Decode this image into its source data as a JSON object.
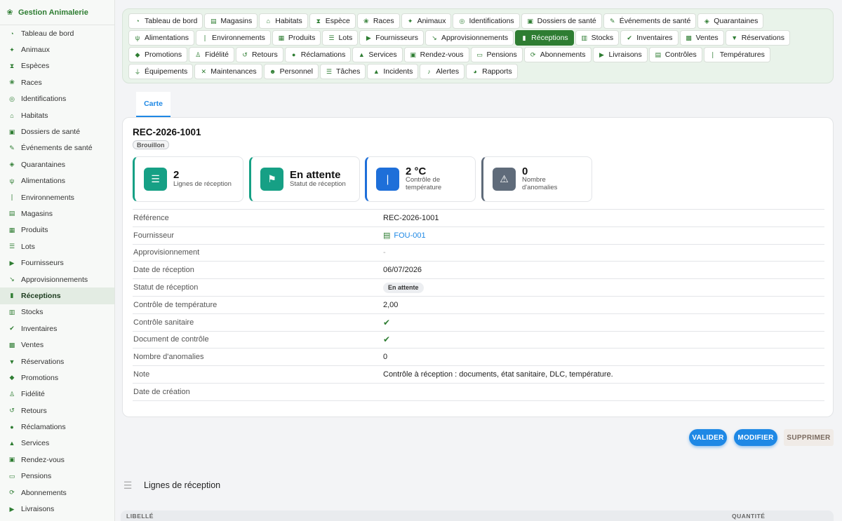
{
  "app": {
    "title": "Gestion Animalerie"
  },
  "sidebar": {
    "items": [
      {
        "label": "Tableau de bord",
        "icon": "dashboard-icon",
        "glyph": "◔"
      },
      {
        "label": "Animaux",
        "icon": "dog-icon",
        "glyph": "✦"
      },
      {
        "label": "Espèces",
        "icon": "hourglass-icon",
        "glyph": "⧗"
      },
      {
        "label": "Races",
        "icon": "paw-icon",
        "glyph": "❀"
      },
      {
        "label": "Identifications",
        "icon": "fingerprint-icon",
        "glyph": "◎"
      },
      {
        "label": "Habitats",
        "icon": "home-icon",
        "glyph": "⌂"
      },
      {
        "label": "Dossiers de santé",
        "icon": "file-medical-icon",
        "glyph": "▣"
      },
      {
        "label": "Événements de santé",
        "icon": "syringe-icon",
        "glyph": "✎"
      },
      {
        "label": "Quarantaines",
        "icon": "shield-icon",
        "glyph": "◈"
      },
      {
        "label": "Alimentations",
        "icon": "utensils-icon",
        "glyph": "ψ"
      },
      {
        "label": "Environnements",
        "icon": "thermometer-icon",
        "glyph": "❘"
      },
      {
        "label": "Magasins",
        "icon": "store-icon",
        "glyph": "▤"
      },
      {
        "label": "Produits",
        "icon": "box-icon",
        "glyph": "▦"
      },
      {
        "label": "Lots",
        "icon": "layers-icon",
        "glyph": "☰"
      },
      {
        "label": "Fournisseurs",
        "icon": "truck-icon",
        "glyph": "▶"
      },
      {
        "label": "Approvisionnements",
        "icon": "dolly-icon",
        "glyph": "↘"
      },
      {
        "label": "Réceptions",
        "icon": "truck-loading-icon",
        "glyph": "▮"
      },
      {
        "label": "Stocks",
        "icon": "warehouse-icon",
        "glyph": "▥"
      },
      {
        "label": "Inventaires",
        "icon": "clipboard-check-icon",
        "glyph": "✔"
      },
      {
        "label": "Ventes",
        "icon": "cash-register-icon",
        "glyph": "▩"
      },
      {
        "label": "Réservations",
        "icon": "bookmark-icon",
        "glyph": "▼"
      },
      {
        "label": "Promotions",
        "icon": "tags-icon",
        "glyph": "◆"
      },
      {
        "label": "Fidélité",
        "icon": "award-icon",
        "glyph": "♙"
      },
      {
        "label": "Retours",
        "icon": "undo-icon",
        "glyph": "↺"
      },
      {
        "label": "Réclamations",
        "icon": "comment-icon",
        "glyph": "●"
      },
      {
        "label": "Services",
        "icon": "concierge-bell-icon",
        "glyph": "▲"
      },
      {
        "label": "Rendez-vous",
        "icon": "calendar-check-icon",
        "glyph": "▣"
      },
      {
        "label": "Pensions",
        "icon": "bed-icon",
        "glyph": "▭"
      },
      {
        "label": "Abonnements",
        "icon": "sync-icon",
        "glyph": "⟳"
      },
      {
        "label": "Livraisons",
        "icon": "shipping-fast-icon",
        "glyph": "▶"
      }
    ],
    "active_index": 16
  },
  "nav_tabs": [
    {
      "label": "Tableau de bord",
      "icon": "dashboard-icon",
      "glyph": "◔"
    },
    {
      "label": "Magasins",
      "icon": "store-icon",
      "glyph": "▤"
    },
    {
      "label": "Habitats",
      "icon": "home-icon",
      "glyph": "⌂"
    },
    {
      "label": "Espèce",
      "icon": "hourglass-icon",
      "glyph": "⧗"
    },
    {
      "label": "Races",
      "icon": "paw-icon",
      "glyph": "❀"
    },
    {
      "label": "Animaux",
      "icon": "dog-icon",
      "glyph": "✦"
    },
    {
      "label": "Identifications",
      "icon": "fingerprint-icon",
      "glyph": "◎"
    },
    {
      "label": "Dossiers de santé",
      "icon": "file-medical-icon",
      "glyph": "▣"
    },
    {
      "label": "Événements de santé",
      "icon": "syringe-icon",
      "glyph": "✎"
    },
    {
      "label": "Quarantaines",
      "icon": "shield-icon",
      "glyph": "◈"
    },
    {
      "label": "Alimentations",
      "icon": "utensils-icon",
      "glyph": "ψ"
    },
    {
      "label": "Environnements",
      "icon": "thermometer-icon",
      "glyph": "❘"
    },
    {
      "label": "Produits",
      "icon": "box-icon",
      "glyph": "▦"
    },
    {
      "label": "Lots",
      "icon": "layers-icon",
      "glyph": "☰"
    },
    {
      "label": "Fournisseurs",
      "icon": "truck-icon",
      "glyph": "▶"
    },
    {
      "label": "Approvisionnements",
      "icon": "dolly-icon",
      "glyph": "↘"
    },
    {
      "label": "Réceptions",
      "icon": "truck-loading-icon",
      "glyph": "▮"
    },
    {
      "label": "Stocks",
      "icon": "warehouse-icon",
      "glyph": "▥"
    },
    {
      "label": "Inventaires",
      "icon": "clipboard-check-icon",
      "glyph": "✔"
    },
    {
      "label": "Ventes",
      "icon": "cash-register-icon",
      "glyph": "▩"
    },
    {
      "label": "Réservations",
      "icon": "bookmark-icon",
      "glyph": "▼"
    },
    {
      "label": "Promotions",
      "icon": "tags-icon",
      "glyph": "◆"
    },
    {
      "label": "Fidélité",
      "icon": "award-icon",
      "glyph": "♙"
    },
    {
      "label": "Retours",
      "icon": "undo-icon",
      "glyph": "↺"
    },
    {
      "label": "Réclamations",
      "icon": "comment-icon",
      "glyph": "●"
    },
    {
      "label": "Services",
      "icon": "concierge-bell-icon",
      "glyph": "▲"
    },
    {
      "label": "Rendez-vous",
      "icon": "calendar-check-icon",
      "glyph": "▣"
    },
    {
      "label": "Pensions",
      "icon": "bed-icon",
      "glyph": "▭"
    },
    {
      "label": "Abonnements",
      "icon": "sync-icon",
      "glyph": "⟳"
    },
    {
      "label": "Livraisons",
      "icon": "shipping-fast-icon",
      "glyph": "▶"
    },
    {
      "label": "Contrôles",
      "icon": "clipboard-icon",
      "glyph": "▤"
    },
    {
      "label": "Températures",
      "icon": "thermometer-icon",
      "glyph": "❘"
    },
    {
      "label": "Équipements",
      "icon": "plug-icon",
      "glyph": "⏚"
    },
    {
      "label": "Maintenances",
      "icon": "tools-icon",
      "glyph": "✕"
    },
    {
      "label": "Personnel",
      "icon": "users-icon",
      "glyph": "☻"
    },
    {
      "label": "Tâches",
      "icon": "tasks-icon",
      "glyph": "☰"
    },
    {
      "label": "Incidents",
      "icon": "warning-icon",
      "glyph": "▲"
    },
    {
      "label": "Alertes",
      "icon": "bell-icon",
      "glyph": "♪"
    },
    {
      "label": "Rapports",
      "icon": "chart-pie-icon",
      "glyph": "◕"
    }
  ],
  "nav_active_index": 16,
  "view_tab": {
    "label": "Carte"
  },
  "record": {
    "title": "REC-2026-1001",
    "status_badge": "Brouillon"
  },
  "stats": [
    {
      "value": "2",
      "label": "Lignes de réception",
      "icon": "list-icon",
      "glyph": "☰",
      "color": "#16a085",
      "border": "#16a085"
    },
    {
      "value": "En attente",
      "label": "Statut de réception",
      "icon": "flag-icon",
      "glyph": "⚑",
      "color": "#16a085",
      "border": "#16a085"
    },
    {
      "value": "2 °C",
      "label": "Contrôle de température",
      "icon": "thermometer-icon",
      "glyph": "❘",
      "color": "#1e6fd9",
      "border": "#1e6fd9"
    },
    {
      "value": "0",
      "label": "Nombre d'anomalies",
      "icon": "warning-icon",
      "glyph": "⚠",
      "color": "#5f6b7a",
      "border": "#5f6b7a"
    }
  ],
  "details": [
    {
      "key": "Référence",
      "value": "REC-2026-1001",
      "type": "text"
    },
    {
      "key": "Fournisseur",
      "value": "FOU-001",
      "type": "link",
      "icon": "store-icon"
    },
    {
      "key": "Approvisionnement",
      "value": "-",
      "type": "muted"
    },
    {
      "key": "Date de réception",
      "value": "06/07/2026",
      "type": "text"
    },
    {
      "key": "Statut de réception",
      "value": "En attente",
      "type": "pill"
    },
    {
      "key": "Contrôle de température",
      "value": "2,00",
      "type": "text"
    },
    {
      "key": "Contrôle sanitaire",
      "value": "✔",
      "type": "check"
    },
    {
      "key": "Document de contrôle",
      "value": "✔",
      "type": "check"
    },
    {
      "key": "Nombre d'anomalies",
      "value": "0",
      "type": "text"
    },
    {
      "key": "Note",
      "value": "Contrôle à réception : documents, état sanitaire, DLC, température.",
      "type": "text"
    },
    {
      "key": "Date de création",
      "value": "",
      "type": "text"
    }
  ],
  "actions": {
    "validate": "VALIDER",
    "edit": "MODIFIER",
    "delete": "SUPPRIMER"
  },
  "lines_section": {
    "title": "Lignes de réception",
    "columns": [
      "LIBELLÉ",
      "QUANTITÉ"
    ]
  },
  "colors": {
    "brand_green": "#2e7d32",
    "accent_blue": "#1e88e5"
  }
}
